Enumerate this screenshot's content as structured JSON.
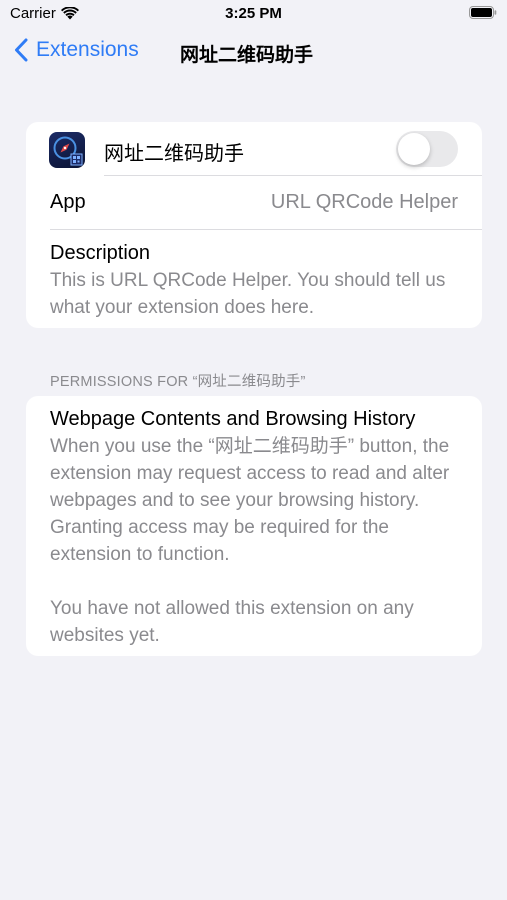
{
  "status_bar": {
    "carrier": "Carrier",
    "time": "3:25 PM"
  },
  "nav": {
    "back_label": "Extensions",
    "title": "网址二维码助手"
  },
  "extension": {
    "name": "网址二维码助手",
    "enabled": false,
    "app_label": "App",
    "app_value": "URL QRCode Helper",
    "description_label": "Description",
    "description_text": "This is URL QRCode Helper. You should tell us what your extension does here."
  },
  "permissions": {
    "header": "PERMISSIONS FOR “网址二维码助手”",
    "title": "Webpage Contents and Browsing History",
    "body": "When you use the “网址二维码助手” button, the extension may request access to read and alter webpages and to see your browsing history. Granting access may be required for the extension to function.",
    "status": "You have not allowed this extension on any websites yet."
  },
  "colors": {
    "accent": "#2f7cf6",
    "background": "#f2f2f7",
    "secondary_text": "#8a8a8e",
    "toggle_off": "#e9e9eb"
  },
  "icons": {
    "wifi": "wifi-icon",
    "battery": "battery-icon",
    "back": "chevron-left-icon",
    "app": "safari-compass-qr-icon"
  }
}
